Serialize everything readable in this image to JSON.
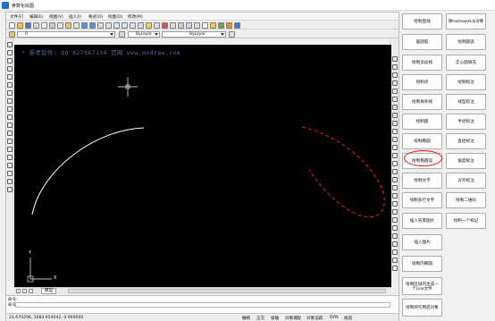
{
  "window": {
    "title": "参数化绘图"
  },
  "menubar": {
    "items": [
      "文件(F)",
      "编辑(E)",
      "视图(V)",
      "插入(I)",
      "格式(O)",
      "绘图(D)",
      "修改(M)"
    ]
  },
  "toolbar_layers": {
    "layer_value": "0",
    "color_value": "ByLayer",
    "linetype_value": "ByLayer"
  },
  "canvas": {
    "watermark": "* 参考软件: QQ 827867134  官网 www.mxdraw.com",
    "ucs_y_label": "Y",
    "ucs_x_label": "X",
    "background": "#000000",
    "arc_color": "#ffffff",
    "ellipse_color": "#e02020"
  },
  "tabs": {
    "model_tab": "模型"
  },
  "command": {
    "prompt_1": "命令:",
    "prompt_2": "命令:"
  },
  "status": {
    "coordinates": "21.670296, 1683.654042, 0.000000",
    "items": [
      "栅格",
      "正交",
      "极轴",
      "对象捕捉",
      "对象追踪",
      "DYN",
      "线宽"
    ]
  },
  "panel": {
    "buttons": [
      "绘制直线",
      "弹mxDrawXLib对象",
      "画圆弧",
      "绘制圆弧",
      "绘制多段线",
      "实心圆填充",
      "绘制点",
      "绘制标注",
      "绘制样条线",
      "线型标注",
      "绘制圆",
      "半径标注",
      "绘制椭圆",
      "直径标注",
      "绘制椭圆弧",
      "角度标注",
      "绘制文字",
      "对齐标注",
      "绘制多行文字",
      "绘制二维码",
      "插入背景图片",
      "绘制一个标记",
      "插入图片",
      "绘制内椭圆",
      "绘制区域内生成一个Line文件",
      "绘制块引用后对象"
    ],
    "highlighted_button": "绘制椭圆弧",
    "highlight_color": "#e02020"
  }
}
